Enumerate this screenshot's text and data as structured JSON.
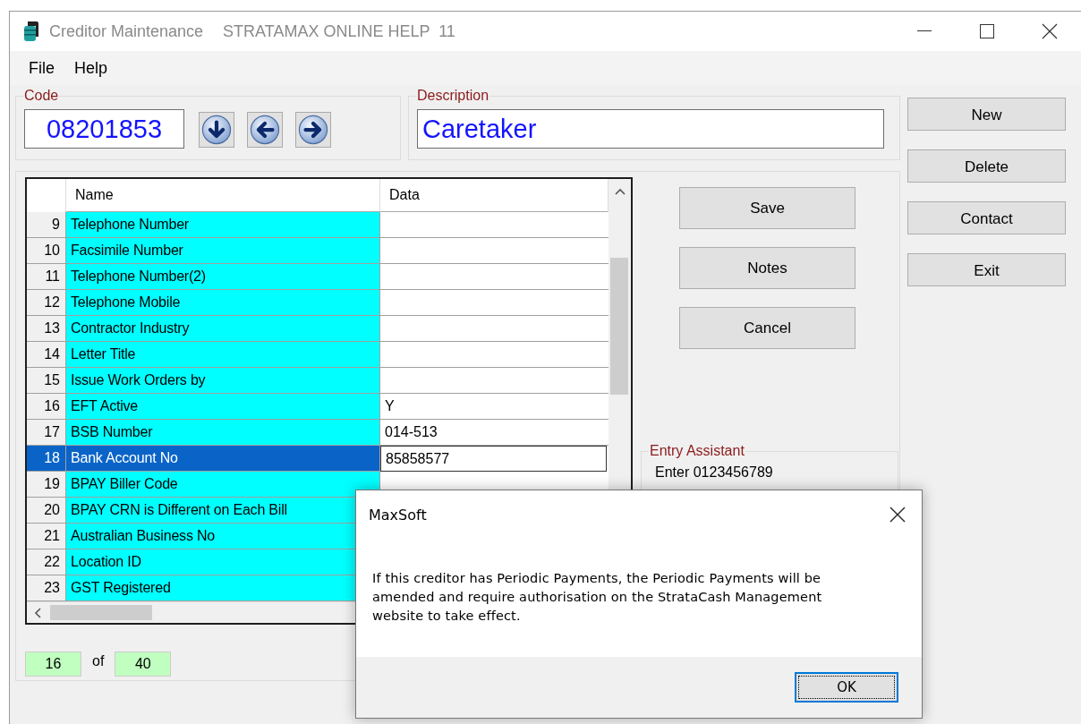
{
  "window": {
    "title": "Creditor Maintenance",
    "subtitle": "STRATAMAX ONLINE HELP  11"
  },
  "menu": [
    {
      "label": "File"
    },
    {
      "label": "Help"
    }
  ],
  "code": {
    "label": "Code",
    "value": "08201853"
  },
  "description": {
    "label": "Description",
    "value": "Caretaker"
  },
  "nav_buttons": [
    {
      "kind": "down"
    },
    {
      "kind": "left"
    },
    {
      "kind": "right"
    }
  ],
  "side_buttons": [
    {
      "label": "New"
    },
    {
      "label": "Delete"
    },
    {
      "label": "Contact"
    },
    {
      "label": "Exit"
    }
  ],
  "grid": {
    "columns": [
      "Name",
      "Data"
    ],
    "rows": [
      {
        "no": "9",
        "name": "Telephone Number",
        "selected": false
      },
      {
        "no": "10",
        "name": "Facsimile Number",
        "selected": false
      },
      {
        "no": "11",
        "name": "Telephone Number(2)",
        "selected": false
      },
      {
        "no": "12",
        "name": "Telephone Mobile",
        "selected": false
      },
      {
        "no": "13",
        "name": "Contractor Industry",
        "selected": false
      },
      {
        "no": "14",
        "name": "Letter Title",
        "selected": false
      },
      {
        "no": "15",
        "name": "Issue Work Orders by",
        "selected": false
      },
      {
        "no": "16",
        "name": "EFT Active",
        "data": "Y",
        "selected": false
      },
      {
        "no": "17",
        "name": "BSB Number",
        "data": "014-513",
        "selected": false
      },
      {
        "no": "18",
        "name": "Bank Account No",
        "data": "85858577",
        "selected": true
      },
      {
        "no": "19",
        "name": "BPAY Biller Code",
        "selected": false
      },
      {
        "no": "20",
        "name": "BPAY CRN is Different on Each Bill",
        "selected": false
      },
      {
        "no": "21",
        "name": "Australian Business No",
        "selected": false
      },
      {
        "no": "22",
        "name": "Location ID",
        "selected": false
      },
      {
        "no": "23",
        "name": "GST Registered",
        "selected": false
      }
    ]
  },
  "action_buttons": [
    {
      "label": "Save"
    },
    {
      "label": "Notes"
    },
    {
      "label": "Cancel"
    }
  ],
  "entry_assistant": {
    "label": "Entry Assistant",
    "text": "Enter 0123456789"
  },
  "counter": {
    "current": "16",
    "of": "of",
    "total": "40"
  },
  "dialog": {
    "title": "MaxSoft",
    "message": "If this creditor has Periodic Payments, the Periodic Payments will be amended and require authorisation on the StrataCash Management website to take effect.",
    "button": "OK"
  }
}
